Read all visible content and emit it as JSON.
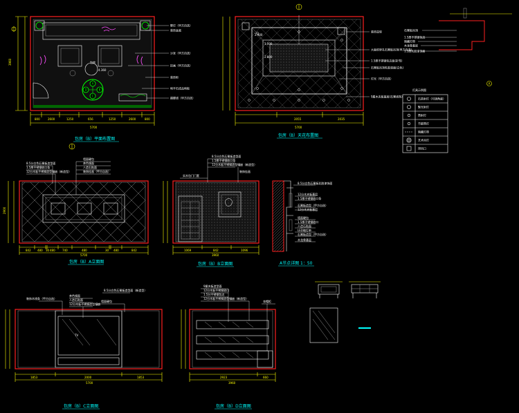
{
  "views": {
    "plan": {
      "title": "包房（B）平面布置图"
    },
    "ceiling": {
      "title": "包房（B）天花布置图"
    },
    "elev_a": {
      "title": "包房（B）A立面图"
    },
    "elev_b": {
      "title": "包房（B）B立面图"
    },
    "detail": {
      "title": "A节点详图 1：50"
    },
    "elev_c": {
      "title": "包房（B）C立面图"
    },
    "elev_d": {
      "title": "包房（B）D立面图"
    }
  },
  "plan_labels": [
    "壁灯（甲方自选）",
    "装饰盆栽",
    "沙发（甲方自选）",
    "挂画（甲方自选）",
    "装饰柜",
    "地平石成品地板",
    "踢脚线（甲方自选）"
  ],
  "plan_table_value": "4.360",
  "compass_letters": [
    "A",
    "B",
    "C",
    "D"
  ],
  "plan_dims_bottom": [
    "800",
    "2600",
    "1250",
    "656",
    "1250",
    "2600",
    "800"
  ],
  "plan_dim_total": "5700",
  "plan_dim_left": "3960",
  "ceiling_labels": [
    "装饰造型",
    "大面积穿孔石膏板吊顶(甲方自选)",
    "1.5厚不锈钢包边板(折弯)",
    "石膏板吊顶乳胶漆面(白色)",
    "灯光（甲方自选）",
    "9厘木夹板基层(石膏线条)"
  ],
  "ceiling_heights": [
    "2.900",
    "3.000",
    "2.800"
  ],
  "ceiling_dims_bottom": [
    "2055",
    "2035"
  ],
  "ceiling_dim_total": "5700",
  "legend": {
    "title": "灯具示例图",
    "items": [
      "石英射灯（可调角度）",
      "聚光射灯",
      "筒射灯",
      "节能筒灯",
      "暗藏灯带",
      "艺术吊灯",
      "排风口"
    ]
  },
  "corner_detail_labels": [
    "石膏板吊顶",
    "1.5厚不锈钢包边",
    "暗藏灯带",
    "木龙骨基层",
    "1.5厚乳胶漆饰面"
  ],
  "elev_a_labels": [
    "8.5分白色石膏板造型面",
    "1.5厚不锈钢收口条",
    "12分木板不锈钢造型镶嵌（新造型）",
    "墙面硬包",
    "茶色镜面",
    "人造石贴面",
    "装饰挂画（甲方自选）"
  ],
  "elev_a_dims": [
    "842",
    "480",
    "30",
    "480",
    "740",
    "480",
    "30",
    "480",
    "842"
  ],
  "elev_a_dim_total": "5700",
  "elev_a_height": "2900",
  "elev_b_labels": [
    "8.5分白色石膏板造型面",
    "1.5厚不锈钢收口条",
    "12分木板不锈钢造型镶嵌（新造型）",
    "实木包门门套",
    "装饰挂画"
  ],
  "elev_b_dims": [
    "1069",
    "842",
    "1096"
  ],
  "elev_b_dim_total": "3960",
  "detail_labels": [
    "8.5分白色石膏板乳胶漆饰面",
    "12分木夹板基层",
    "1.5厚不锈钢收口条",
    "石膏板造型（甲方自选）",
    "12分木夹板基层",
    "墙面硬包",
    "1.5厚不锈钢收口",
    "人造石贴面",
    "LED暗灯带",
    "石膏板造型（甲方自选）",
    "木龙骨基层"
  ],
  "elev_c_labels": [
    "装饰木线条（甲方自选）",
    "茶色镜面",
    "人造石贴面",
    "12分木板不锈钢造型镶嵌",
    "墙面硬包",
    "8.5分白色石膏板造型面（新造型）"
  ],
  "tv_label": "TV",
  "elev_c_dims": [
    "1853",
    "2000",
    "1853"
  ],
  "elev_c_dim_total": "5700",
  "elev_d_labels": [
    "9厘夹板造型面",
    "12分木板不锈钢收口",
    "1.5分不锈钢包边",
    "12分木板不锈钢造型镶嵌（新造型）",
    "衣帽柜"
  ],
  "elev_d_dims": [
    "2923",
    "660"
  ],
  "elev_d_dim_total": "3960"
}
